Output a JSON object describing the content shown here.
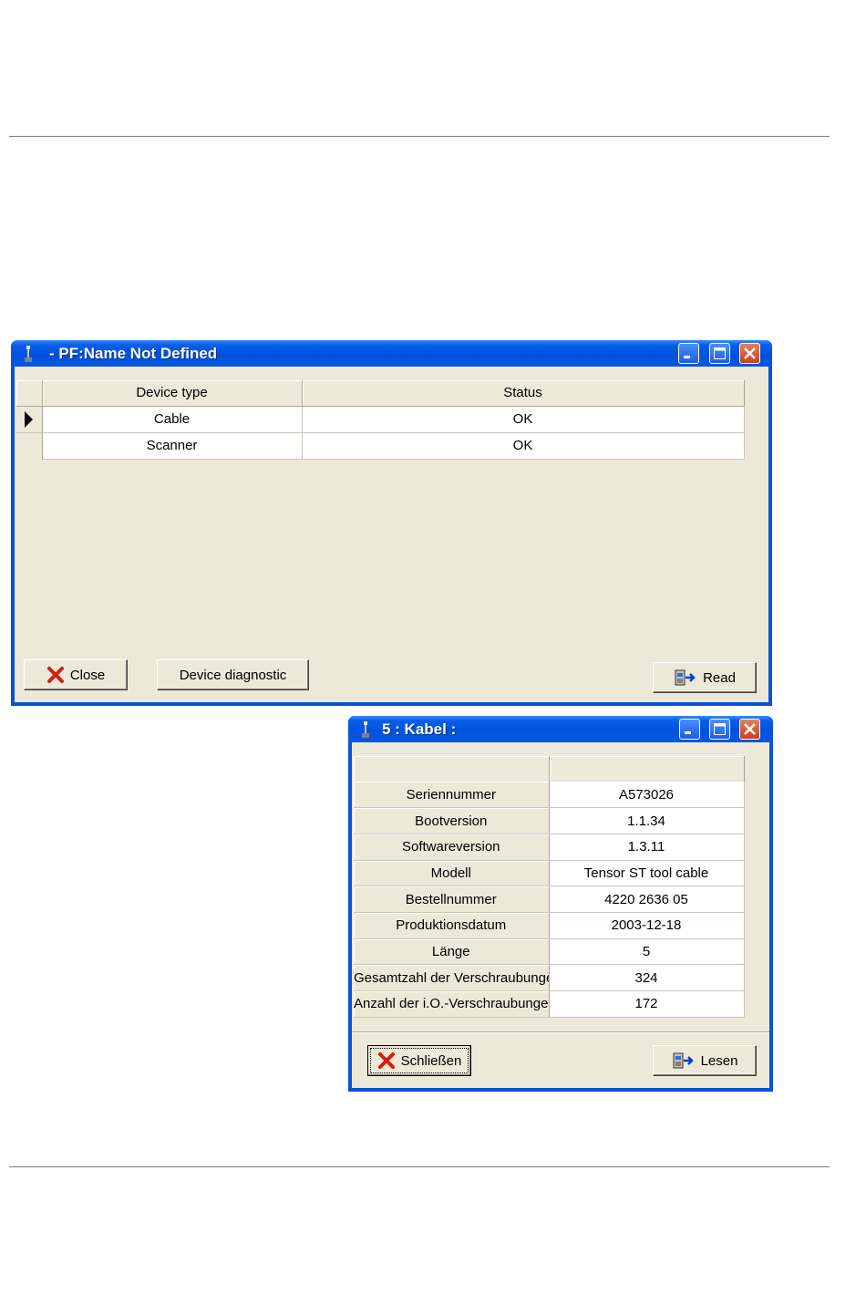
{
  "window1": {
    "title": "- PF:Name Not Defined",
    "columns": [
      "Device type",
      "Status"
    ],
    "rows": [
      {
        "device_type": "Cable",
        "status": "OK"
      },
      {
        "device_type": "Scanner",
        "status": "OK"
      }
    ],
    "buttons": {
      "close": "Close",
      "diagnostic": "Device diagnostic",
      "read": "Read"
    }
  },
  "window2": {
    "title": "5 : Kabel :",
    "rows": [
      {
        "label": "Seriennummer",
        "value": "A573026"
      },
      {
        "label": "Bootversion",
        "value": "1.1.34"
      },
      {
        "label": "Softwareversion",
        "value": "1.3.11"
      },
      {
        "label": "Modell",
        "value": "Tensor ST tool cable"
      },
      {
        "label": "Bestellnummer",
        "value": "4220 2636 05"
      },
      {
        "label": "Produktionsdatum",
        "value": "2003-12-18"
      },
      {
        "label": "Länge",
        "value": "5"
      },
      {
        "label": "Gesamtzahl der Verschraubungen",
        "value": "324"
      },
      {
        "label": "Anzahl der i.O.-Verschraubungen",
        "value": "172"
      }
    ],
    "buttons": {
      "close": "Schließen",
      "read": "Lesen"
    }
  },
  "colors": {
    "title_bar": "#0052de",
    "client": "#ece9d8",
    "close_x": "#d0200f"
  }
}
